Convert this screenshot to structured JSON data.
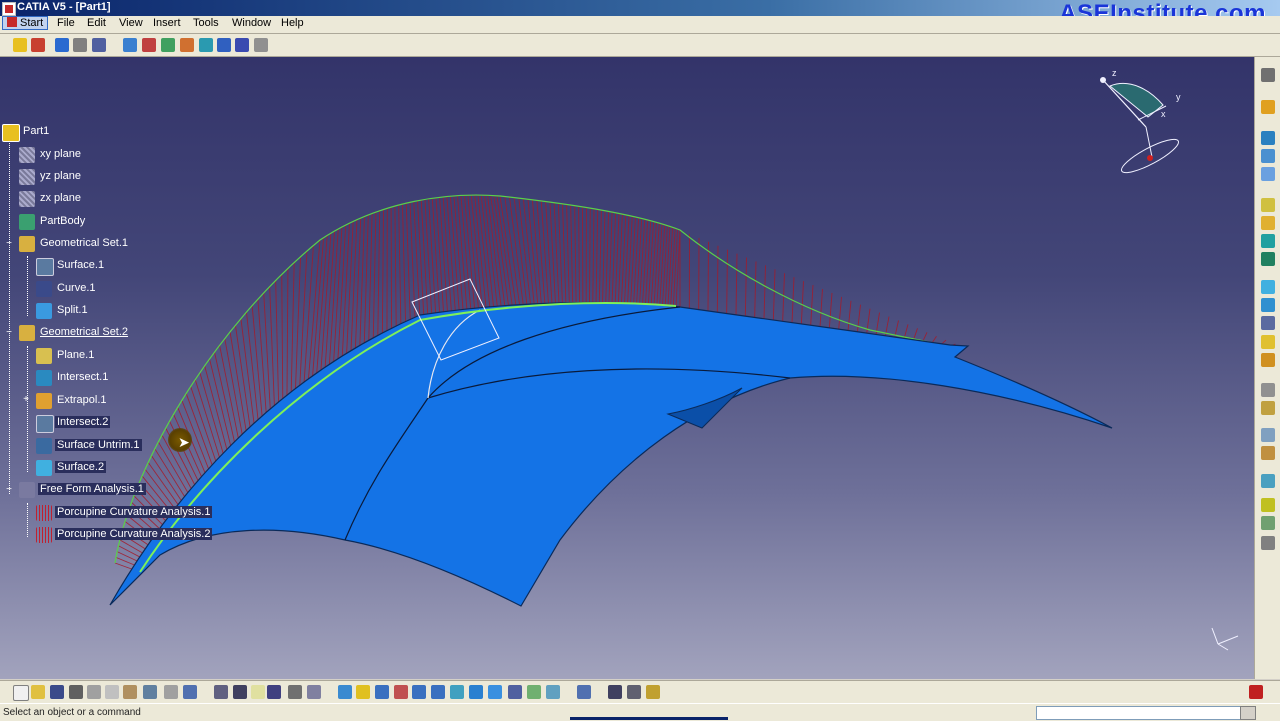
{
  "window": {
    "title": "CATIA V5 - [Part1]",
    "brand": "ASEInstitute.com"
  },
  "menu": {
    "items": [
      {
        "label": "Start",
        "active": true
      },
      {
        "label": "File"
      },
      {
        "label": "Edit"
      },
      {
        "label": "View"
      },
      {
        "label": "Insert"
      },
      {
        "label": "Tools"
      },
      {
        "label": "Window"
      },
      {
        "label": "Help"
      }
    ]
  },
  "tree": {
    "root": "Part1",
    "nodes": [
      {
        "label": "xy plane",
        "icon": "plane-icon"
      },
      {
        "label": "yz plane",
        "icon": "plane-icon"
      },
      {
        "label": "zx plane",
        "icon": "plane-icon"
      },
      {
        "label": "PartBody",
        "icon": "body-icon"
      },
      {
        "label": "Geometrical Set.1",
        "icon": "geometrical-set-icon"
      },
      {
        "label": "Surface.1",
        "icon": "surface-icon"
      },
      {
        "label": "Curve.1",
        "icon": "curve-icon"
      },
      {
        "label": "Split.1",
        "icon": "split-icon"
      },
      {
        "label": "Geometrical Set.2",
        "icon": "geometrical-set-icon",
        "underlined": true
      },
      {
        "label": "Plane.1",
        "icon": "plane-icon"
      },
      {
        "label": "Intersect.1",
        "icon": "intersect-icon"
      },
      {
        "label": "Extrapol.1",
        "icon": "extrapol-icon"
      },
      {
        "label": "Intersect.2",
        "icon": "intersect-icon"
      },
      {
        "label": "Surface Untrim.1",
        "icon": "untrim-icon"
      },
      {
        "label": "Surface.2",
        "icon": "surface-icon"
      },
      {
        "label": "Free Form Analysis.1",
        "icon": "analysis-icon"
      },
      {
        "label": "Porcupine Curvature Analysis.1",
        "icon": "porcupine-icon"
      },
      {
        "label": "Porcupine Curvature Analysis.2",
        "icon": "porcupine-icon"
      }
    ]
  },
  "compass": {
    "x": "x",
    "y": "y",
    "z": "z"
  },
  "status": {
    "message": "Select an object or a command",
    "command_input": ""
  },
  "colors": {
    "surface": "#1473e6",
    "surface_edge": "#0a2a5a",
    "porcupine": "#a41a2a",
    "boundary_curve": "#5ad04a",
    "background_top": "#33346a",
    "background_bottom": "#a2a3bd"
  }
}
